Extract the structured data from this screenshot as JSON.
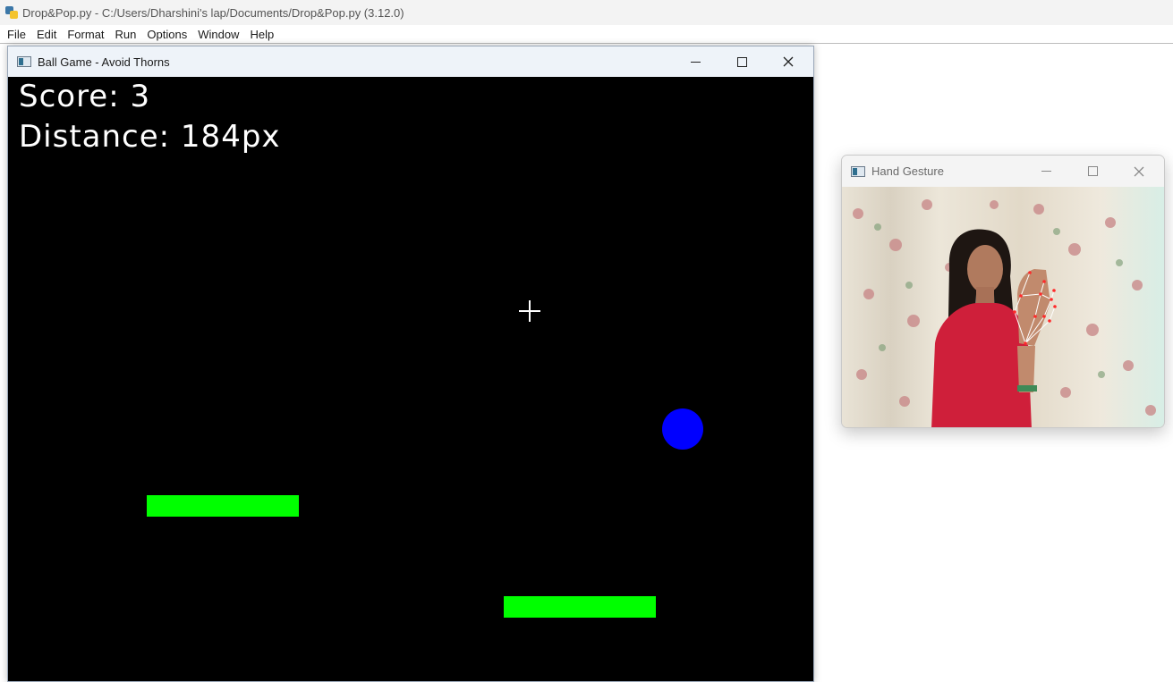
{
  "idle": {
    "title": "Drop&Pop.py - C:/Users/Dharshini's lap/Documents/Drop&Pop.py (3.12.0)",
    "menu": [
      "File",
      "Edit",
      "Format",
      "Run",
      "Options",
      "Window",
      "Help"
    ]
  },
  "game_window": {
    "title": "Ball Game - Avoid Thorns",
    "score_text": "Score: 3",
    "distance_text": "Distance: 184px",
    "colors": {
      "background": "#000000",
      "platform": "#00ff00",
      "ball": "#0000ff",
      "text": "#ffffff"
    }
  },
  "hand_window": {
    "title": "Hand Gesture",
    "camera_feed": "webcam-hand-landmarks"
  },
  "icons": {
    "minimize": "minimize-icon",
    "maximize": "maximize-icon",
    "close": "close-icon"
  }
}
